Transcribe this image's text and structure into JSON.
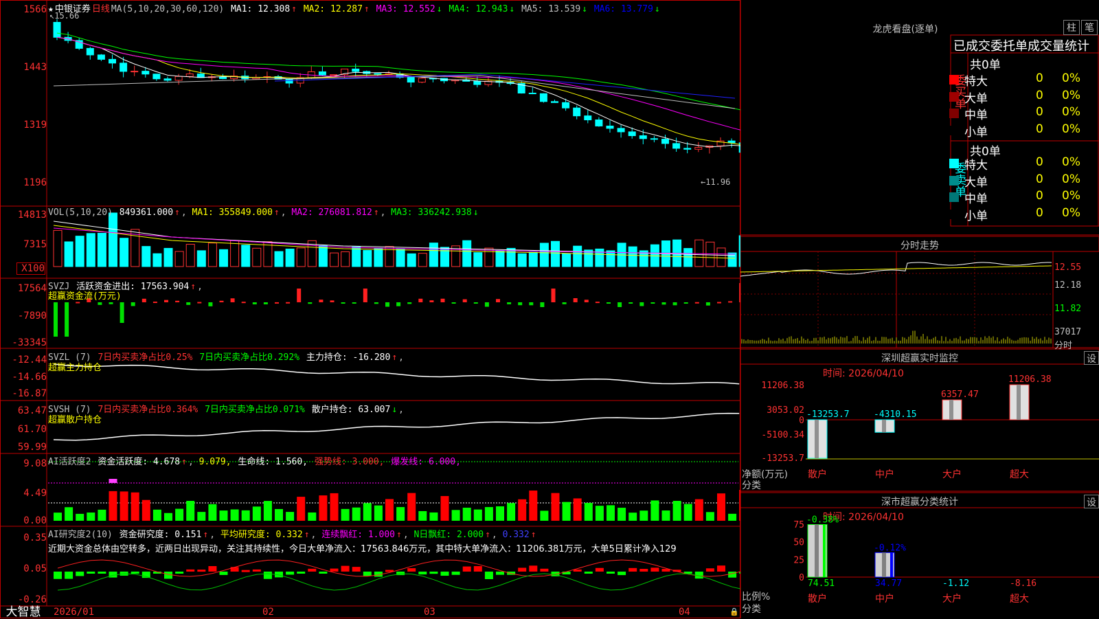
{
  "left": {
    "kline": {
      "y_ticks": [
        "1566",
        "1443",
        "1319",
        "1196"
      ],
      "title": "中银证券",
      "period": "日线",
      "ma_label": "MA(5,10,20,30,60,120)",
      "ma_values": [
        {
          "name": "MA1:",
          "value": "12.308",
          "arrow": "↑",
          "color": "#ffffff"
        },
        {
          "name": "MA2:",
          "value": "12.287",
          "arrow": "↑",
          "color": "#ffff00"
        },
        {
          "name": "MA3:",
          "value": "12.552",
          "arrow": "↓",
          "color": "#ff00ff"
        },
        {
          "name": "MA4:",
          "value": "12.943",
          "arrow": "↓",
          "color": "#00ff00"
        },
        {
          "name": "MA5:",
          "value": "13.539",
          "arrow": "↓",
          "color": "#c0c0c0"
        },
        {
          "name": "MA6:",
          "value": "13.779",
          "arrow": "↓",
          "color": "#0000ff"
        }
      ],
      "high_marker": "15.66",
      "low_marker": "11.96"
    },
    "vol": {
      "label": "VOL(5,10,20)",
      "value": "849361.000",
      "ma1": "MA1: 355849.000",
      "ma2": "MA2: 276081.812",
      "ma3": "MA3: 336242.938",
      "y_ticks": [
        "14813",
        "7315",
        "X100"
      ]
    },
    "svzj": {
      "label": "SVZJ",
      "text": "活跃资金进出: 17563.904",
      "title": "超赢资金流(万元)",
      "y_ticks": [
        "17564",
        "-7890",
        "-33345"
      ]
    },
    "svzl": {
      "label": "SVZL (7)",
      "t1": "7日内买卖净占比0.25%",
      "t2": "7日内买卖净占比0.292%",
      "t3": "主力持仓: -16.280",
      "title": "超赢主力持仓",
      "y_ticks": [
        "-12.44",
        "-14.66",
        "-16.87"
      ]
    },
    "svsh": {
      "label": "SVSH (7)",
      "t1": "7日内买卖净占比0.364%",
      "t2": "7日内买卖净占比0.071%",
      "t3": "散户持仓: 63.007",
      "title": "超赢散户持仓",
      "y_ticks": [
        "63.47",
        "61.70",
        "59.99"
      ]
    },
    "ai1": {
      "label": "AI活跃度2",
      "t1": "资金活跃度: 4.678",
      "t2": "9.079,",
      "t3": "生命线: 1.560,",
      "t4": "强势线: 3.000,",
      "t5": "爆发线: 6.000,",
      "y_ticks": [
        "9.08",
        "4.49",
        "0.00"
      ]
    },
    "ai2": {
      "label": "AI研究度2(10)",
      "t1": "资金研究度: 0.151",
      "t2": "平均研究度: 0.332",
      "t3": "连续飘红: 1.000",
      "t4": "N日飘红: 2.000",
      "t5": "0.332",
      "comment": "近期大资金总体由空转多，近两日出现异动，关注其持续性，今日大单净流入：17563.846万元，其中特大单净流入：11206.381万元，大单5日累计净入129",
      "y_ticks": [
        "0.35",
        "0.05",
        "-0.26"
      ]
    },
    "date_axis": [
      "2026/01",
      "02",
      "03",
      "04"
    ],
    "brand": "大智慧"
  },
  "right": {
    "lhb": {
      "title": "龙虎看盘(逐单)",
      "btn1": "柱",
      "btn2": "笔",
      "header": "已成交委托单成交量统计",
      "buy_label": "委买单",
      "sell_label": "委卖单",
      "buy_total": "共0单",
      "sell_total": "共0单",
      "buy_rows": [
        {
          "label": "特大",
          "count": "0",
          "pct": "0%",
          "color": "#ff0000"
        },
        {
          "label": "大单",
          "count": "0",
          "pct": "0%",
          "color": "#a00000"
        },
        {
          "label": "中单",
          "count": "0",
          "pct": "0%",
          "color": "#800000"
        },
        {
          "label": "小单",
          "count": "0",
          "pct": "0%",
          "color": "#000000"
        }
      ],
      "sell_rows": [
        {
          "label": "特大",
          "count": "0",
          "pct": "0%",
          "color": "#00ffff"
        },
        {
          "label": "大单",
          "count": "0",
          "pct": "0%",
          "color": "#008c8c"
        },
        {
          "label": "中单",
          "count": "0",
          "pct": "0%",
          "color": "#007878"
        },
        {
          "label": "小单",
          "count": "0",
          "pct": "0%",
          "color": "#000000"
        }
      ]
    },
    "fenshi": {
      "title": "分时走势",
      "y_ticks": [
        "12.55",
        "12.18",
        "11.82",
        "37017"
      ],
      "footer": "分时"
    },
    "sz_monitor": {
      "title": "深圳超赢实时监控",
      "btn": "设",
      "time_label": "时间: 2026/04/10",
      "y_ticks": [
        "11206.38",
        "3053.02",
        "0",
        "-5100.34",
        "-13253.7"
      ],
      "axis_title": "净额(万元)",
      "axis_title2": "分类",
      "bars": [
        {
          "cat": "散户",
          "value": -13253.7,
          "label": "-13253.7",
          "label_color": "#00ffff"
        },
        {
          "cat": "中户",
          "value": -4310.15,
          "label": "-4310.15",
          "label_color": "#00ffff"
        },
        {
          "cat": "大户",
          "value": 6357.47,
          "label": "6357.47",
          "label_color": "#ff3232"
        },
        {
          "cat": "超大",
          "value": 11206.38,
          "label": "11206.38",
          "label_color": "#ff3232"
        }
      ]
    },
    "sz_class": {
      "title": "深市超赢分类统计",
      "btn": "设",
      "time_label": "时间: 2026/04/10",
      "y_ticks": [
        "75",
        "50",
        "25",
        "0"
      ],
      "axis_title": "比例%",
      "axis_title2": "分类",
      "bars": [
        {
          "cat": "散户",
          "value": 74.51,
          "label": "74.51",
          "top_label": "-0.38%",
          "color": "#00ff00",
          "label_color": "#00ff00"
        },
        {
          "cat": "中户",
          "value": 34.77,
          "label": "34.77",
          "top_label": "-0.12%",
          "color": "#0000ff",
          "label_color": "#0000ff"
        },
        {
          "cat": "大户",
          "value": 0,
          "label": "-1.12",
          "top_label": "",
          "color": "#00ffff",
          "label_color": "#00ffff"
        },
        {
          "cat": "超大",
          "value": 0,
          "label": "-8.16",
          "top_label": "",
          "color": "#ff3232",
          "label_color": "#ff3232"
        }
      ]
    }
  },
  "colors": {
    "up": "#ff3232",
    "down": "#00ffff",
    "frame": "#c00000",
    "bg": "#000000"
  }
}
